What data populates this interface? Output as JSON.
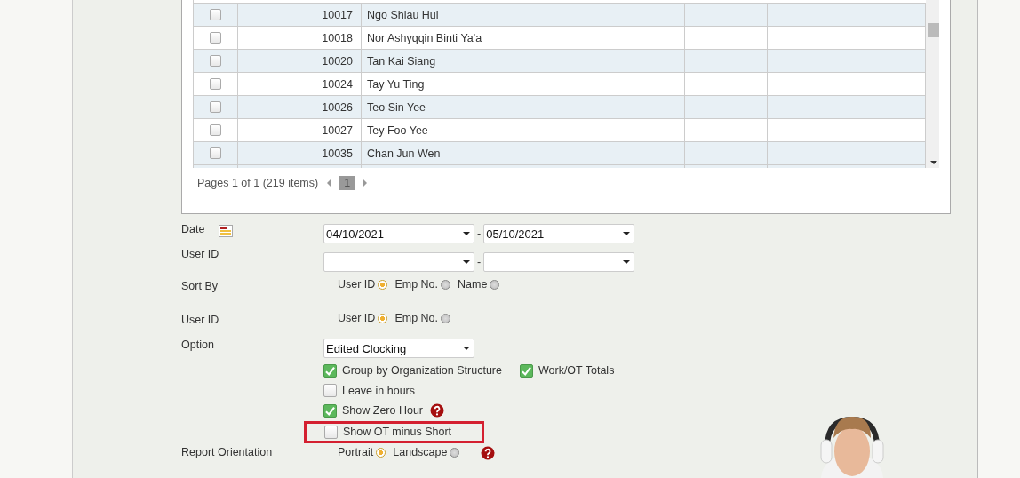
{
  "table": {
    "rows": [
      {
        "checked": false,
        "id": "10017",
        "name": "Ngo Shiau Hui"
      },
      {
        "checked": false,
        "id": "10018",
        "name": "Nor Ashyqqin Binti Ya'a"
      },
      {
        "checked": false,
        "id": "10020",
        "name": "Tan Kai Siang"
      },
      {
        "checked": false,
        "id": "10024",
        "name": "Tay Yu Ting"
      },
      {
        "checked": false,
        "id": "10026",
        "name": "Teo Sin Yee"
      },
      {
        "checked": false,
        "id": "10027",
        "name": "Tey Foo Yee"
      },
      {
        "checked": false,
        "id": "10035",
        "name": "Chan Jun Wen"
      }
    ]
  },
  "pager": {
    "summary": "Pages 1 of 1 (219 items)",
    "pages": [
      {
        "label": "1",
        "selected": true
      }
    ]
  },
  "form": {
    "date": {
      "label": "Date",
      "from": "04/10/2021",
      "separator": "-",
      "to": "05/10/2021"
    },
    "user_range": {
      "label": "User ID",
      "separator": "-"
    },
    "sort_by": {
      "label": "Sort By",
      "options": [
        {
          "label": "User ID",
          "selected": true
        },
        {
          "label": "Emp No.",
          "selected": false
        },
        {
          "label": "Name",
          "selected": false
        }
      ]
    },
    "user_id": {
      "label": "User ID",
      "options": [
        {
          "label": "User ID",
          "selected": true
        },
        {
          "label": "Emp No.",
          "selected": false
        }
      ]
    },
    "option": {
      "label": "Option",
      "value": "Edited Clocking",
      "checkbox_rows": [
        [
          {
            "label": "Group by Organization Structure",
            "checked": true,
            "help": false,
            "highlighted": false
          },
          {
            "label": "Work/OT Totals",
            "checked": true,
            "help": false,
            "highlighted": false
          }
        ],
        [
          {
            "label": "Leave in hours",
            "checked": false,
            "help": false,
            "highlighted": false
          }
        ],
        [
          {
            "label": "Show Zero Hour",
            "checked": true,
            "help": true,
            "highlighted": false
          }
        ],
        [
          {
            "label": "Show OT minus Short",
            "checked": false,
            "help": false,
            "highlighted": true
          }
        ]
      ]
    },
    "orientation": {
      "label": "Report Orientation",
      "options": [
        {
          "label": "Portrait",
          "selected": true
        },
        {
          "label": "Landscape",
          "selected": false
        }
      ],
      "help": true
    }
  }
}
